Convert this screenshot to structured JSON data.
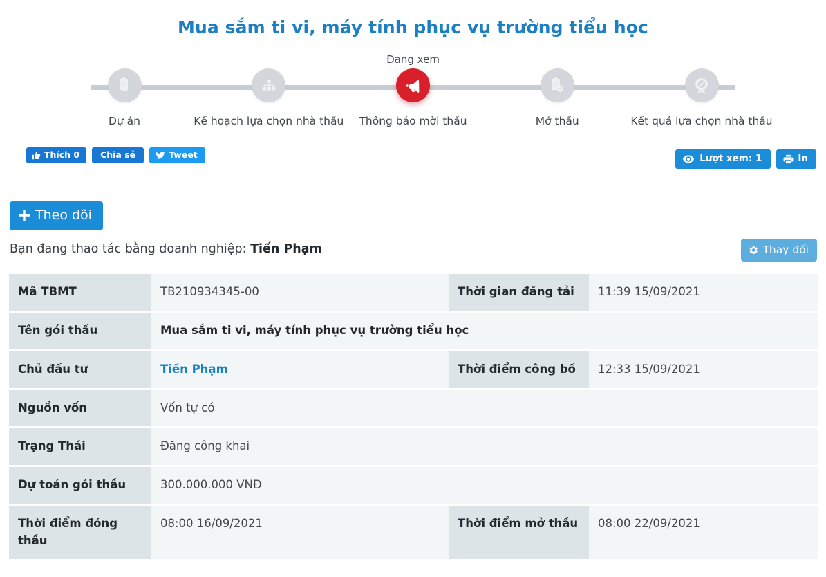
{
  "page": {
    "title": "Mua sắm ti vi, máy tính phục vụ trường tiểu học"
  },
  "stepper": {
    "current_flag": "Đang xem",
    "steps": [
      {
        "label": "Dự án",
        "icon": "clipboard-hand-icon",
        "state": "done"
      },
      {
        "label": "Kế hoạch lựa chọn nhà thầu",
        "icon": "sitemap-icon",
        "state": "done"
      },
      {
        "label": "Thông báo mời thầu",
        "icon": "megaphone-icon",
        "state": "current"
      },
      {
        "label": "Mở thầu",
        "icon": "clipboard-shield-icon",
        "state": "upcoming"
      },
      {
        "label": "Kết quả lựa chọn nhà thầu",
        "icon": "award-check-icon",
        "state": "upcoming"
      }
    ]
  },
  "social": {
    "like_label": "Thích 0",
    "share_label": "Chia sẻ",
    "tweet_label": "Tweet",
    "views_label": "Lượt xem: 1",
    "print_label": "In"
  },
  "actions": {
    "follow_label": "Theo dõi",
    "acting_prefix": "Bạn đang thao tác bằng doanh nghiệp:",
    "acting_business": "Tiến Phạm",
    "change_label": "Thay đổi"
  },
  "info": {
    "rows": [
      {
        "label": "Mã TBMT",
        "value": "TB210934345-00",
        "label2": "Thời gian đăng tải",
        "value2": "11:39 15/09/2021"
      },
      {
        "label": "Tên gói thầu",
        "value": "Mua sắm ti vi, máy tính phục vụ trường tiểu học",
        "label2": "",
        "value2": ""
      },
      {
        "label": "Chủ đầu tư",
        "value": "Tiến Phạm",
        "label2": "Thời điểm công bố",
        "value2": "12:33 15/09/2021"
      },
      {
        "label": "Nguồn vốn",
        "value": "Vốn tự có",
        "label2": "",
        "value2": ""
      },
      {
        "label": "Trạng Thái",
        "value": "Đăng công khai",
        "label2": "",
        "value2": ""
      },
      {
        "label": "Dự toán gói thầu",
        "value": "300.000.000 VNĐ",
        "label2": "",
        "value2": ""
      },
      {
        "label": "Thời điểm đóng thầu",
        "value": "08:00 16/09/2021",
        "label2": "Thời điểm mở thầu",
        "value2": "08:00 22/09/2021"
      }
    ]
  },
  "colors": {
    "title_blue": "#1b7fc4",
    "current_red": "#d81f2a",
    "step_gray": "#d3d7dc",
    "primary_blue": "#1b8cd8",
    "facebook_blue": "#1877d2",
    "twitter_blue": "#1d9bf0",
    "change_blue": "#5dadde",
    "label_bg": "#dde4e8",
    "value_bg": "#f2f6f7"
  }
}
